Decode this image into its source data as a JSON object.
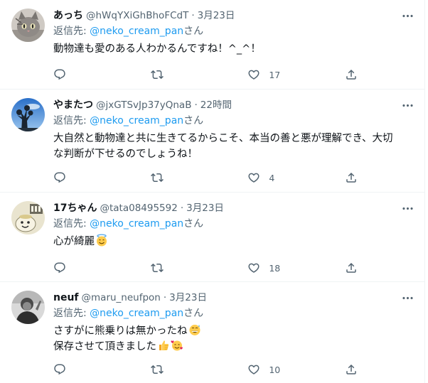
{
  "tweets": [
    {
      "name": "あっち",
      "handle": "@hWqYXiGhBhoFCdT",
      "dot": "·",
      "time": "3月23日",
      "reply_prefix": "返信先: ",
      "reply_mention": "@neko_cream_pan",
      "reply_suffix": "さん",
      "lines": [
        "動物達も愛のある人わかるんですね！^_^！"
      ],
      "likes": "17",
      "avatar": "cat-photo"
    },
    {
      "name": "やまたつ",
      "handle": "@jxGTSvJp37yQnaB",
      "dot": "·",
      "time": "22時間",
      "reply_prefix": "返信先: ",
      "reply_mention": "@neko_cream_pan",
      "reply_suffix": "さん",
      "lines": [
        "大自然と動物達と共に生きてるからこそ、本当の善と悪が理解でき、大切",
        "な判断が下せるのでしょうね！"
      ],
      "likes": "4",
      "avatar": "sky-tree-photo"
    },
    {
      "name": "17ちゃん",
      "handle": "@tata08495592",
      "dot": "·",
      "time": "3月23日",
      "reply_prefix": "返信先: ",
      "reply_mention": "@neko_cream_pan",
      "reply_suffix": "さん",
      "lines": [
        "心が綺麗"
      ],
      "likes": "18",
      "avatar": "character-illustration",
      "emojis": [
        "smiling-face-with-halo-emoji"
      ]
    },
    {
      "name": "neuf",
      "handle": "@maru_neufpon",
      "dot": "·",
      "time": "3月23日",
      "reply_prefix": "返信先: ",
      "reply_mention": "@neko_cream_pan",
      "reply_suffix": "さん",
      "lines": [
        "さすがに熊乗りは無かったね",
        "保存させて頂きました"
      ],
      "likes": "10",
      "avatar": "monochrome-person-photo",
      "emojis": [
        "grinning-sweat-emoji",
        "thumbs-up-emoji",
        "smiling-face-with-hearts-emoji"
      ]
    }
  ],
  "icons": {
    "more": "more-horizontal-icon",
    "reply": "reply-bubble-icon",
    "retweet": "retweet-arrows-icon",
    "like": "heart-icon",
    "share": "share-upload-icon"
  },
  "colors": {
    "link": "#1d9bf0",
    "secondary_text": "#536471",
    "primary_text": "#0f1419",
    "divider": "#eff3f4"
  }
}
